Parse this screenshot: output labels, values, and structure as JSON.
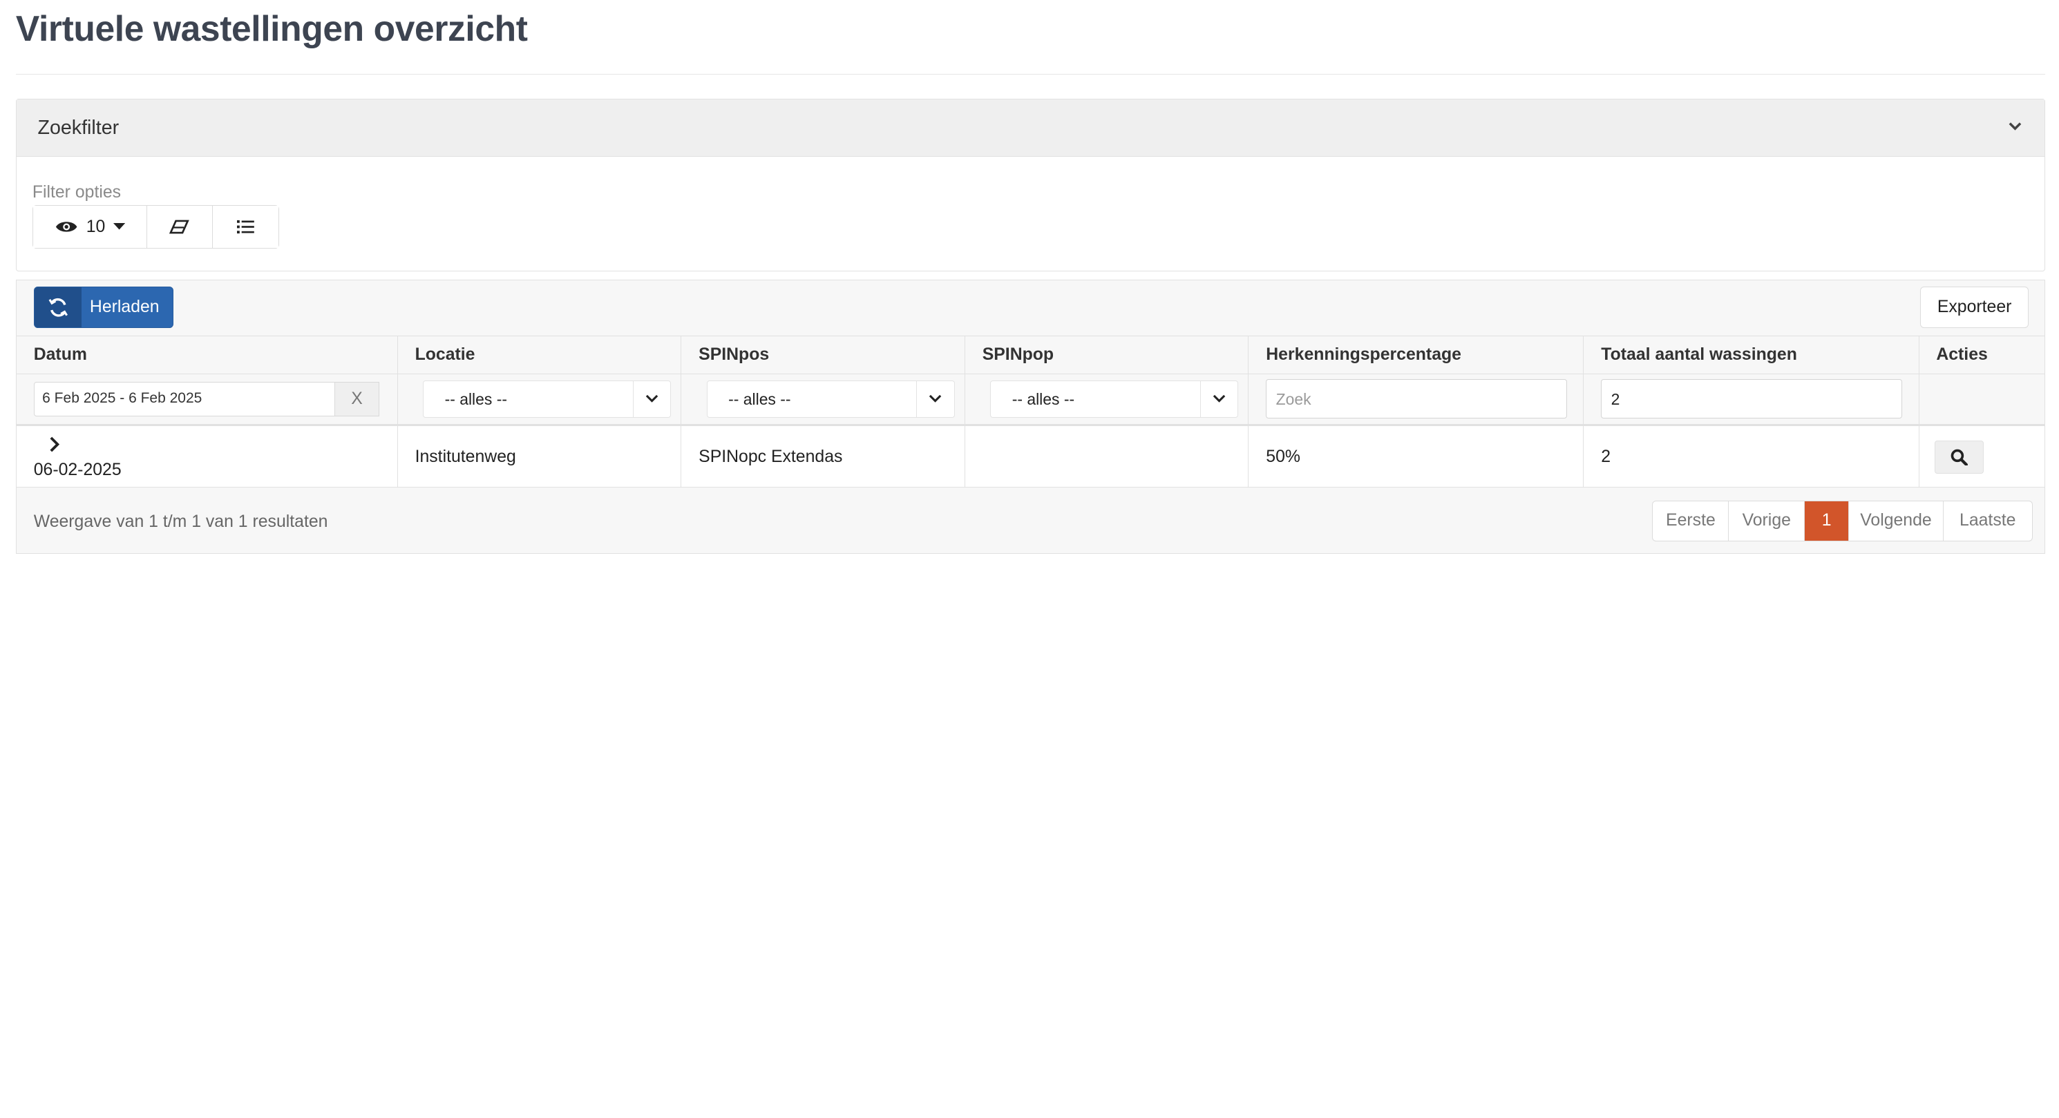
{
  "page": {
    "title": "Virtuele wastellingen overzicht"
  },
  "filter_panel": {
    "title": "Zoekfilter",
    "options_label": "Filter opties",
    "page_size": "10"
  },
  "toolbar": {
    "reload_label": "Herladen",
    "export_label": "Exporteer"
  },
  "table": {
    "columns": [
      "Datum",
      "Locatie",
      "SPINpos",
      "SPINpop",
      "Herkenningspercentage",
      "Totaal aantal wassingen",
      "Acties"
    ],
    "filters": {
      "date_range": "6 Feb 2025 - 6 Feb 2025",
      "date_clear": "X",
      "locatie": "-- alles --",
      "spinpos": "-- alles --",
      "spinpop": "-- alles --",
      "herkenning_placeholder": "Zoek",
      "totaal_value": "2"
    },
    "rows": [
      {
        "datum": "06-02-2025",
        "locatie": "Institutenweg",
        "spinpos": "SPINopc Extendas",
        "spinpop": "",
        "herkenning": "50%",
        "totaal": "2"
      }
    ]
  },
  "footer": {
    "summary": "Weergave van 1 t/m 1 van 1 resultaten",
    "pager": {
      "first": "Eerste",
      "prev": "Vorige",
      "current": "1",
      "next": "Volgende",
      "last": "Laatste"
    }
  },
  "colors": {
    "primary": "#2c67b0",
    "active_page": "#d2552a"
  }
}
